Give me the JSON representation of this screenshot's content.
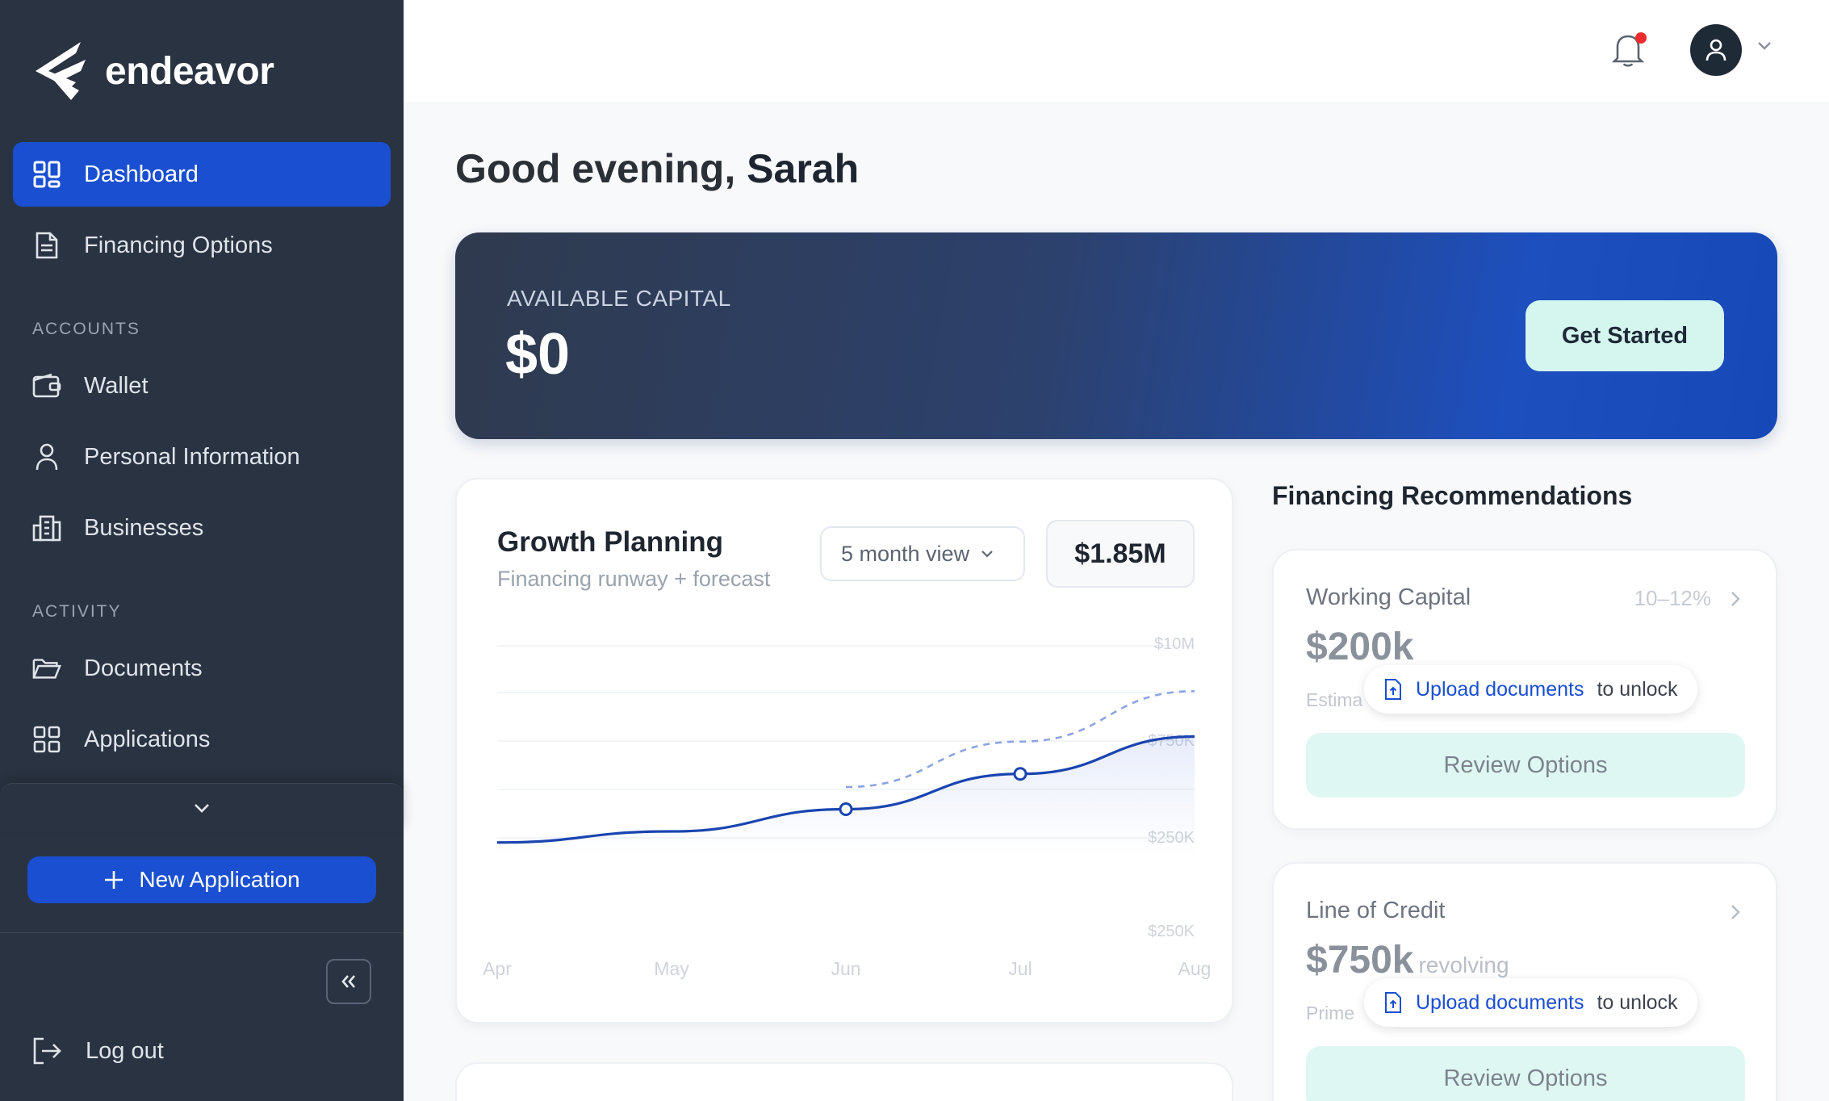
{
  "brand": {
    "name": "endeavor"
  },
  "sidebar": {
    "primary": [
      {
        "label": "Dashboard",
        "icon": "grid-icon",
        "active": true
      },
      {
        "label": "Financing Options",
        "icon": "document-icon",
        "active": false
      }
    ],
    "sections": [
      {
        "label": "ACCOUNTS",
        "items": [
          {
            "label": "Wallet",
            "icon": "wallet-icon"
          },
          {
            "label": "Personal Information",
            "icon": "user-icon"
          },
          {
            "label": "Businesses",
            "icon": "building-icon"
          }
        ]
      },
      {
        "label": "ACTIVITY",
        "items": [
          {
            "label": "Documents",
            "icon": "folder-icon"
          },
          {
            "label": "Applications",
            "icon": "grid-icon"
          }
        ]
      }
    ],
    "new_application": "New Application",
    "logout": "Log out"
  },
  "header": {
    "notification_dot": true
  },
  "greeting": {
    "prefix": "Good evening,",
    "name": "Sarah"
  },
  "capital": {
    "label": "AVAILABLE CAPITAL",
    "value": "$0",
    "cta": "Get Started"
  },
  "growth": {
    "title": "Growth Planning",
    "subtitle": "Financing runway + forecast",
    "view": "5 month view",
    "total": "$1.85M"
  },
  "chart_data": {
    "type": "line",
    "categories": [
      "Apr",
      "May",
      "Jun",
      "Jul",
      "Aug"
    ],
    "y_tick_labels": [
      "$10M",
      "$750K",
      "$250K",
      "$250K"
    ],
    "series": [
      {
        "values": [
          0.05,
          0.16,
          0.38,
          0.73,
          1.1
        ]
      },
      {
        "values": [
          null,
          null,
          0.6,
          1.05,
          1.55
        ]
      }
    ],
    "highlighted_points": [
      "Jun",
      "Jul"
    ],
    "grid": true,
    "colors": {
      "actual": "#1a45b0",
      "forecast": "#8da3e0"
    }
  },
  "recommendations": {
    "title": "Financing Recommendations",
    "cards": [
      {
        "name": "Working Capital",
        "rate": "10–12%",
        "amount": "$200k",
        "amount_suffix": "",
        "note": "Estima",
        "unlock_link": "Upload documents",
        "unlock_rest": "to unlock",
        "cta": "Review Options"
      },
      {
        "name": "Line of Credit",
        "rate": "",
        "amount": "$750k",
        "amount_suffix": "revolving",
        "note": "Prime",
        "unlock_link": "Upload documents",
        "unlock_rest": "to unlock",
        "cta": "Review Options"
      }
    ]
  },
  "colors": {
    "sidebar": "#2a3342",
    "accent": "#1a4fd1",
    "mint": "#d4f6ef"
  }
}
